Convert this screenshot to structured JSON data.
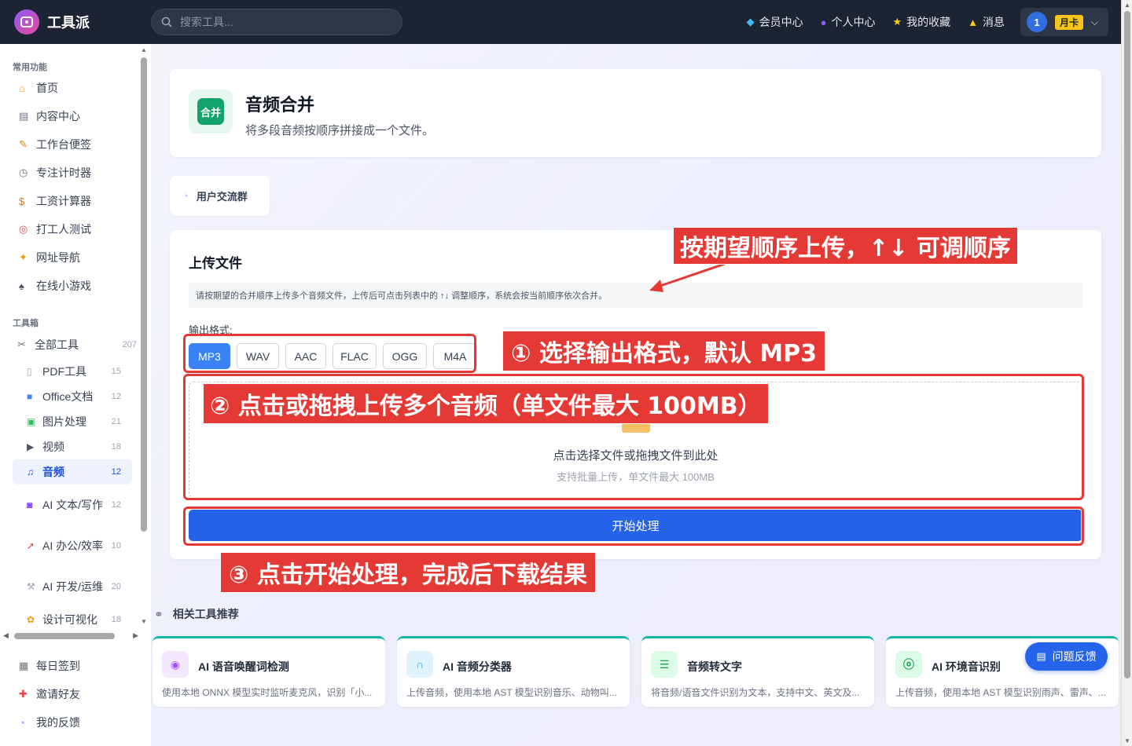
{
  "app": {
    "name": "工具派"
  },
  "search": {
    "placeholder": "搜索工具..."
  },
  "topnav": [
    {
      "label": "会员中心",
      "icon": "diamond-icon"
    },
    {
      "label": "个人中心",
      "icon": "user-icon"
    },
    {
      "label": "我的收藏",
      "icon": "star-icon"
    },
    {
      "label": "消息",
      "icon": "bell-icon"
    }
  ],
  "user": {
    "avatar_text": "1",
    "badge": "月卡"
  },
  "sidebar": {
    "section_common": "常用功能",
    "common_items": [
      {
        "label": "首页",
        "icon": "home-icon"
      },
      {
        "label": "内容中心",
        "icon": "newspaper-icon"
      },
      {
        "label": "工作台便签",
        "icon": "memo-icon"
      },
      {
        "label": "专注计时器",
        "icon": "stopwatch-icon"
      },
      {
        "label": "工资计算器",
        "icon": "money-bag-icon"
      },
      {
        "label": "打工人测试",
        "icon": "target-icon"
      },
      {
        "label": "网址导航",
        "icon": "compass-icon"
      },
      {
        "label": "在线小游戏",
        "icon": "gamepad-icon"
      }
    ],
    "section_tools": "工具箱",
    "all_tools": {
      "label": "全部工具",
      "count": "207"
    },
    "tool_items": [
      {
        "label": "PDF工具",
        "count": "15",
        "icon": "pdf-icon"
      },
      {
        "label": "Office文档",
        "count": "12",
        "icon": "office-icon"
      },
      {
        "label": "图片处理",
        "count": "21",
        "icon": "image-icon"
      },
      {
        "label": "视频",
        "count": "18",
        "icon": "clapper-icon"
      },
      {
        "label": "音频",
        "count": "12",
        "icon": "music-icon"
      },
      {
        "label": "AI 文本/写作",
        "count": "12",
        "icon": "robot-icon"
      },
      {
        "label": "AI 办公/效率",
        "count": "10",
        "icon": "rocket-icon"
      },
      {
        "label": "AI 开发/运维",
        "count": "20",
        "icon": "wrench-icon"
      },
      {
        "label": "设计可视化",
        "count": "18",
        "icon": "palette-icon"
      }
    ],
    "bottom_items": [
      {
        "label": "每日签到",
        "icon": "calendar-icon"
      },
      {
        "label": "邀请好友",
        "icon": "gift-icon"
      },
      {
        "label": "我的反馈",
        "icon": "speech-bubble-icon"
      }
    ]
  },
  "tool": {
    "icon_text": "合并",
    "title": "音频合并",
    "description": "将多段音频按顺序拼接成一个文件。"
  },
  "group_button": "用户交流群",
  "upload": {
    "title": "上传文件",
    "hint": "请按期望的合并顺序上传多个音频文件，上传后可点击列表中的 ↑↓ 调整顺序，系统会按当前顺序依次合并。",
    "format_label": "输出格式:",
    "formats": [
      "MP3",
      "WAV",
      "AAC",
      "FLAC",
      "OGG",
      "M4A"
    ],
    "selected_format": "MP3",
    "drop_main": "点击选择文件或拖拽文件到此处",
    "drop_sub": "支持批量上传，单文件最大 100MB",
    "start_button": "开始处理"
  },
  "annotations": {
    "order": "按期望顺序上传，↑↓ 可调顺序",
    "step1": "① 选择输出格式，默认 MP3",
    "step2": "② 点击或拖拽上传多个音频（单文件最大 100MB）",
    "step3": "③ 点击开始处理，完成后下载结果",
    "color": "#e53935"
  },
  "recommend": {
    "title": "相关工具推荐",
    "items": [
      {
        "name": "AI 语音唤醒词检测",
        "desc": "使用本地 ONNX 模型实时监听麦克风，识别「小...",
        "icon": "mic-icon"
      },
      {
        "name": "AI 音频分类器",
        "desc": "上传音频，使用本地 AST 模型识别音乐、动物叫...",
        "icon": "headphones-icon"
      },
      {
        "name": "音频转文字",
        "desc": "将音频/语音文件识别为文本，支持中文、英文及...",
        "icon": "transcript-icon"
      },
      {
        "name": "AI 环境音识别",
        "desc": "上传音频，使用本地 AST 模型识别雨声、雷声、...",
        "icon": "ear-icon"
      }
    ]
  },
  "feedback_button": "问题反馈"
}
